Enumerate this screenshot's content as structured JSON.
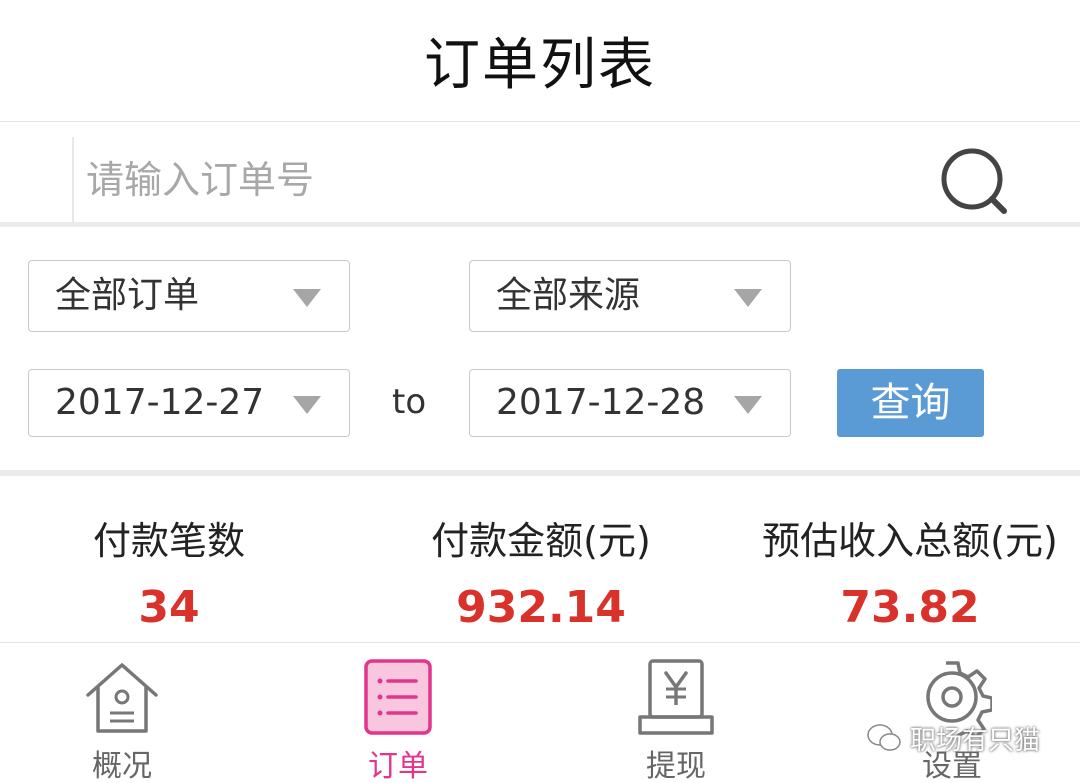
{
  "header": {
    "title": "订单列表"
  },
  "search": {
    "placeholder": "请输入订单号",
    "value": ""
  },
  "filters": {
    "order_type": "全部订单",
    "source": "全部来源",
    "start_date": "2017-12-27",
    "to_label": "to",
    "end_date": "2017-12-28",
    "query_label": "查询"
  },
  "stats": [
    {
      "label": "付款笔数",
      "value": "34"
    },
    {
      "label": "付款金额(元)",
      "value": "932.14"
    },
    {
      "label": "预估收入总额(元)",
      "value": "73.82"
    }
  ],
  "tabs": [
    {
      "label": "概况",
      "icon": "home-icon",
      "active": false
    },
    {
      "label": "订单",
      "icon": "order-list-icon",
      "active": true
    },
    {
      "label": "提现",
      "icon": "withdraw-yen-icon",
      "active": false
    },
    {
      "label": "设置",
      "icon": "gear-icon",
      "active": false
    }
  ],
  "watermark": {
    "text": "职场有只猫"
  },
  "colors": {
    "accent": "#e2358c",
    "highlight_value": "#d9322b",
    "query_button": "#5b9bd5"
  }
}
